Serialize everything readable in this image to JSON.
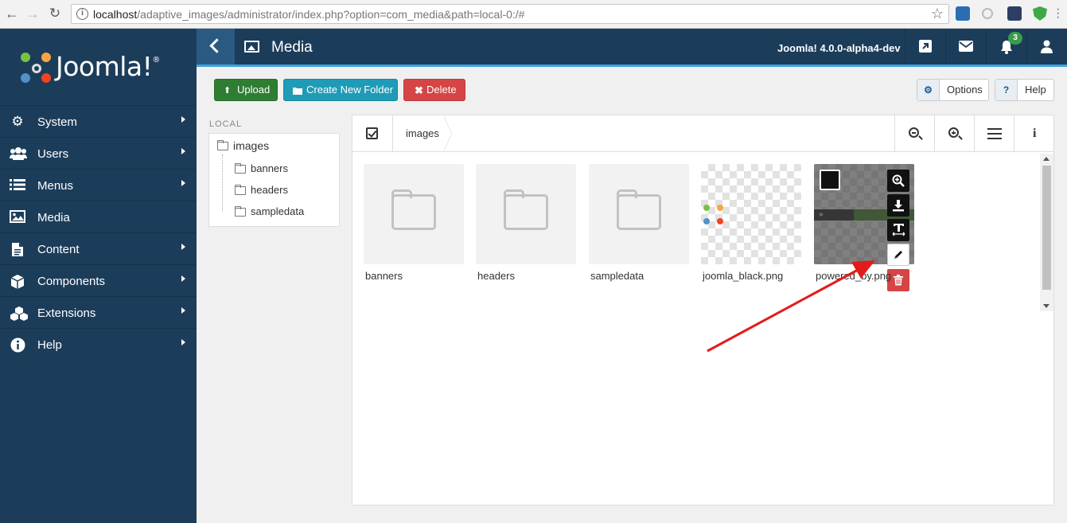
{
  "browser": {
    "url_host": "localhost",
    "url_path": "/adaptive_images/administrator/index.php?option=com_media&path=local-0:/#"
  },
  "sidebar": {
    "logo_text": "Joomla!",
    "items": [
      {
        "label": "System",
        "icon": "gear-icon",
        "has_submenu": true
      },
      {
        "label": "Users",
        "icon": "users-icon",
        "has_submenu": true
      },
      {
        "label": "Menus",
        "icon": "list-icon",
        "has_submenu": true
      },
      {
        "label": "Media",
        "icon": "image-icon",
        "has_submenu": false
      },
      {
        "label": "Content",
        "icon": "file-icon",
        "has_submenu": true
      },
      {
        "label": "Components",
        "icon": "cube-icon",
        "has_submenu": true
      },
      {
        "label": "Extensions",
        "icon": "cubes-icon",
        "has_submenu": true
      },
      {
        "label": "Help",
        "icon": "info-icon",
        "has_submenu": true
      }
    ]
  },
  "header": {
    "title": "Media",
    "version": "Joomla! 4.0.0-alpha4-dev",
    "notifications_count": "3",
    "colors": {
      "bar": "#1c3d5a",
      "accent": "#3ea1de"
    }
  },
  "toolbar": {
    "upload_label": "Upload",
    "new_folder_label": "Create New Folder",
    "delete_label": "Delete",
    "options_label": "Options",
    "help_label": "Help",
    "help_glyph": "?"
  },
  "tree": {
    "heading": "LOCAL",
    "root": "images",
    "children": [
      "banners",
      "headers",
      "sampledata"
    ]
  },
  "browser_panel": {
    "breadcrumb": "images",
    "items": [
      {
        "name": "banners",
        "type": "folder"
      },
      {
        "name": "headers",
        "type": "folder"
      },
      {
        "name": "sampledata",
        "type": "folder"
      },
      {
        "name": "joomla_black.png",
        "type": "image"
      },
      {
        "name": "powered_by.png",
        "type": "image",
        "hovered": true
      }
    ]
  }
}
